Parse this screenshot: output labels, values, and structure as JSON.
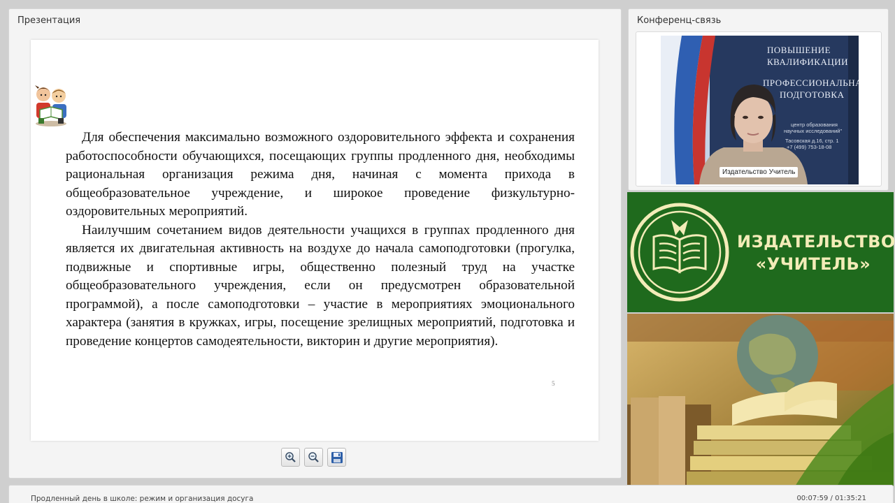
{
  "presentation": {
    "title": "Презентация",
    "slide": {
      "paragraph_1": "Для обеспечения максимально возможного оздоровительного эффекта и сохранения работоспособности обучающихся, посещающих группы продленного дня, необходимы рациональная организация режима дня, начиная с момента прихода в общеобразовательное учреждение, и широкое проведение физкультурно-оздоровительных мероприятий.",
      "paragraph_2": "Наилучшим сочетанием видов деятельности учащихся в группах продленного дня является их двигательная активность на воздухе до начала самоподготовки (прогулка, подвижные и спортивные игры, общественно полезный труд на участке общеобразовательного учреждения, если он предусмотрен образовательной программой), а после самоподготовки – участие в мероприятиях эмоционального характера (занятия в кружках, игры, посещение зрелищных мероприятий, подготовка и проведение концертов самодеятельности, викторин и другие мероприятия).",
      "page_number": "5"
    },
    "toolbar": [
      {
        "icon": "zoom-in-icon"
      },
      {
        "icon": "zoom-out-icon"
      },
      {
        "icon": "save-icon"
      }
    ]
  },
  "conference": {
    "title": "Конференц-связь",
    "banner_line_1": "ПОВЫШЕНИЕ",
    "banner_line_2": "КВАЛИФИКАЦИИ",
    "banner_line_3": "ПРОФЕССИОНАЛЬНАЯ",
    "banner_line_4": "ПОДГОТОВКА",
    "banner_small_1": "центр образования",
    "banner_small_2": "научных исследований\"",
    "banner_small_3": "Тасовская д.16, стр. 1",
    "banner_small_4": "+7 (499) 753-18-08",
    "speaker_name": "Издательство Учитель"
  },
  "publisher": {
    "line_1": "ИЗДАТЕЛЬСТВО",
    "line_2": "«УЧИТЕЛЬ»",
    "brand_green": "#1f6a1d",
    "logo_color": "#f3ecb8"
  },
  "footer": {
    "course_title": "Продленный день в школе: режим и организация досуга",
    "time": "00:07:59 / 01:35:21"
  }
}
